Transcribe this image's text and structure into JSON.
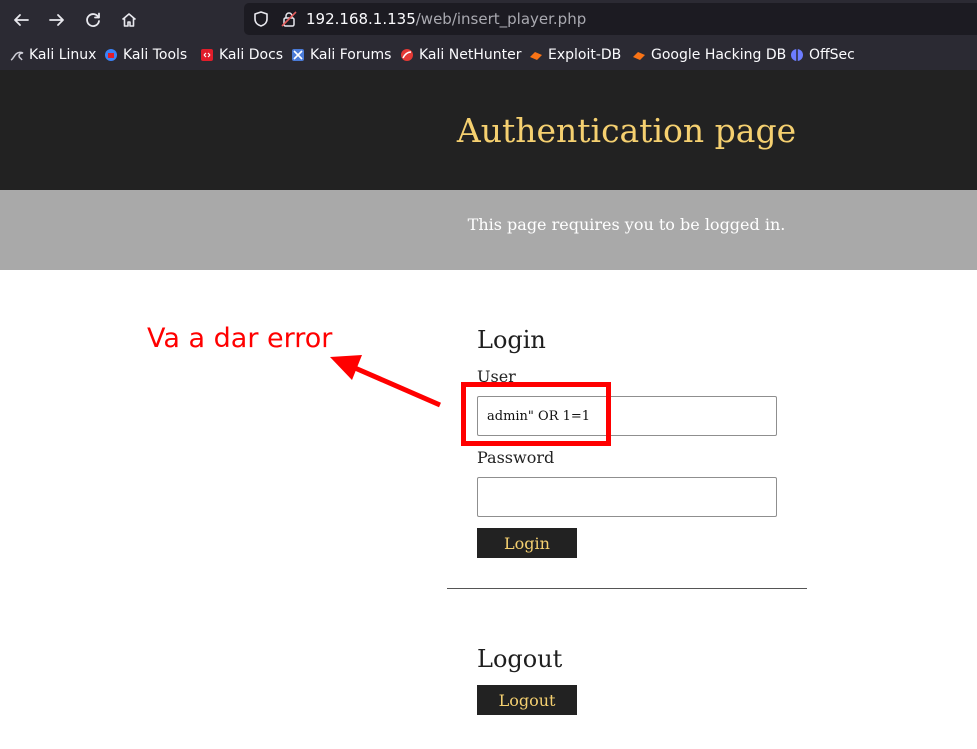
{
  "browser": {
    "url_host": "192.168.1.135",
    "url_path": "/web/insert_player.php",
    "bookmarks": [
      {
        "label": "Kali Linux",
        "icon": "kali-dragon-icon",
        "color": "#cfcfd8"
      },
      {
        "label": "Kali Tools",
        "icon": "kali-tools-icon",
        "color": "#3b82f6"
      },
      {
        "label": "Kali Docs",
        "icon": "kali-docs-icon",
        "color": "#e11d2a"
      },
      {
        "label": "Kali Forums",
        "icon": "kali-forums-icon",
        "color": "#4a7bd8"
      },
      {
        "label": "Kali NetHunter",
        "icon": "kali-nethunter-icon",
        "color": "#e53935"
      },
      {
        "label": "Exploit-DB",
        "icon": "exploit-db-icon",
        "color": "#f97316"
      },
      {
        "label": "Google Hacking DB",
        "icon": "ghdb-icon",
        "color": "#f97316"
      },
      {
        "label": "OffSec",
        "icon": "offsec-icon",
        "color": "#6d7cff"
      }
    ]
  },
  "page": {
    "title": "Authentication page",
    "subtitle": "This page requires you to be logged in."
  },
  "login": {
    "heading": "Login",
    "user_label": "User",
    "user_value": "admin\" OR 1=1",
    "password_label": "Password",
    "password_value": "",
    "button_label": "Login"
  },
  "logout": {
    "heading": "Logout",
    "button_label": "Logout"
  },
  "annotation": {
    "text": "Va a dar error",
    "color": "#ff0000"
  }
}
